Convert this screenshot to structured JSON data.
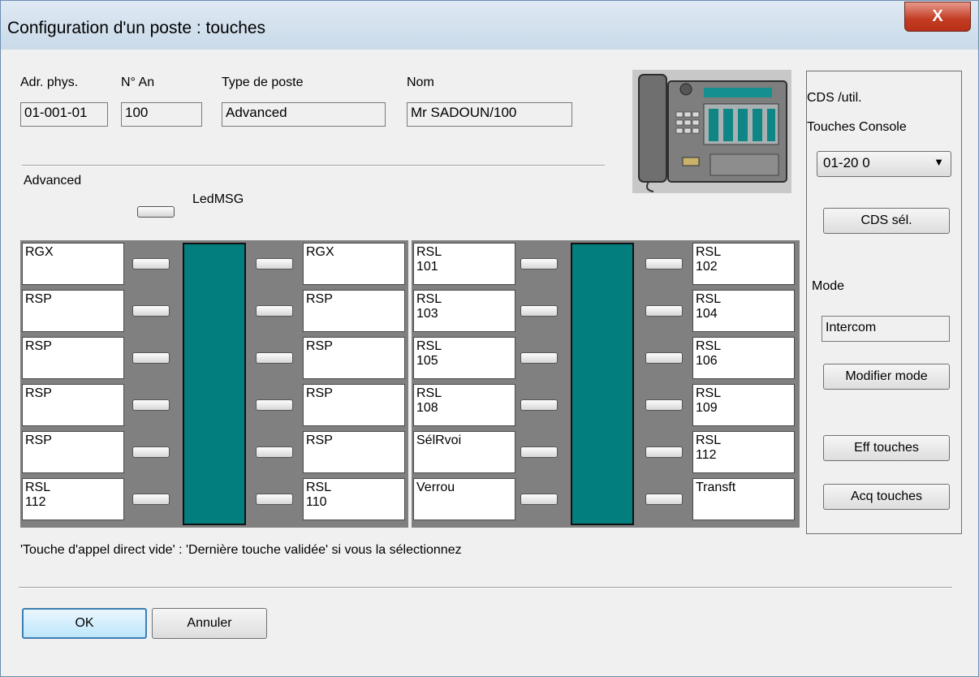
{
  "window": {
    "title": "Configuration d'un poste : touches",
    "close_glyph": "X"
  },
  "fields": {
    "adr_label": "Adr. phys.",
    "adr_value": "01-001-01",
    "nan_label": "N° An",
    "nan_value": "100",
    "type_label": "Type de poste",
    "type_value": "Advanced",
    "nom_label": "Nom",
    "nom_value": "Mr SADOUN/100"
  },
  "model_label": "Advanced",
  "led_label": "LedMSG",
  "left_panel": {
    "left_keys": [
      "RGX",
      "RSP",
      "RSP",
      "RSP",
      "RSP",
      "RSL\n112"
    ],
    "right_keys": [
      "RGX",
      "RSP",
      "RSP",
      "RSP",
      "RSP",
      "RSL\n110"
    ]
  },
  "right_panel": {
    "left_keys": [
      "RSL\n101",
      "RSL\n103",
      "RSL\n105",
      "RSL\n108",
      "SélRvoi",
      "Verrou"
    ],
    "right_keys": [
      "RSL\n102",
      "RSL\n104",
      "RSL\n106",
      "RSL\n109",
      "RSL\n112",
      "Transft"
    ]
  },
  "side": {
    "cds_label": "CDS  /util.",
    "touches_label": "Touches Console",
    "range_select": "01-20   0",
    "cds_button": "CDS sél.",
    "mode_label": "Mode",
    "mode_value": "Intercom",
    "modifier_button": "Modifier mode",
    "eff_button": "Eff touches",
    "acq_button": "Acq touches"
  },
  "hint": "'Touche d'appel direct vide' : 'Dernière touche validée' si vous la sélectionnez",
  "buttons": {
    "ok": "OK",
    "cancel": "Annuler"
  },
  "colors": {
    "teal_panel": "#037e7e",
    "ok_border": "#3c7fb1"
  }
}
